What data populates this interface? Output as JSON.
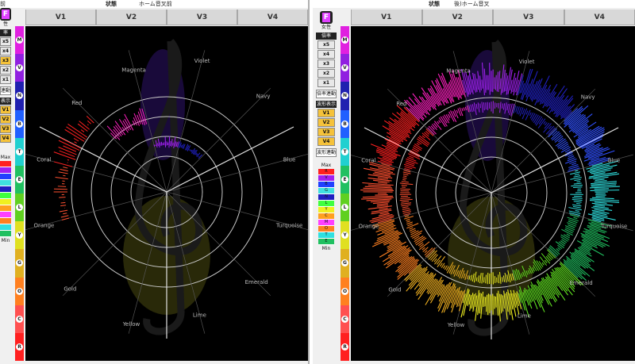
{
  "left": {
    "status_label": "状態",
    "status_value": "ホーム音叉前",
    "tabs": [
      "V1",
      "V2",
      "V3",
      "V4"
    ],
    "logo": "F",
    "partial_title": "前",
    "ctrl": {
      "gender": "性",
      "multiplier_header": "率",
      "multipliers": [
        "x5",
        "x4",
        "x3",
        "x2",
        "x1"
      ],
      "link_button": "連動",
      "wave_header": "表示",
      "wave_buttons": [
        "V1",
        "V2",
        "V3",
        "V4"
      ],
      "max_label": "Max",
      "min_label": "Min"
    }
  },
  "right": {
    "status_label": "状態",
    "status_value": "後)ホーム音叉",
    "tabs": [
      "V1",
      "V2",
      "V3",
      "V4"
    ],
    "logo": "F",
    "ctrl": {
      "gender": "女性",
      "multiplier_header": "倍率",
      "multipliers": [
        "x5",
        "x4",
        "x3",
        "x2",
        "x1"
      ],
      "link_button": "倍率連動",
      "wave_header": "波形表示",
      "wave_buttons": [
        "V1",
        "V2",
        "V3",
        "V4"
      ],
      "wave_link": "波形連動",
      "max_label": "Max",
      "swatches": [
        "R",
        "V",
        "B",
        "G",
        "N",
        "L",
        "Y",
        "C",
        "M",
        "O",
        "T",
        "E"
      ],
      "min_label": "Min"
    }
  },
  "strip_letters": [
    "M",
    "V",
    "N",
    "B",
    "T",
    "E",
    "L",
    "Y",
    "G",
    "O",
    "C",
    "R"
  ],
  "wheel_labels": [
    "Violet",
    "Navy",
    "Blue",
    "Turquoise",
    "Emerald",
    "Lime",
    "Yellow",
    "Gold",
    "Orange",
    "Coral",
    "Red",
    "Magenta"
  ],
  "colors": {
    "Violet": "#a020f0",
    "Navy": "#2020c0",
    "Blue": "#3050ff",
    "Turquoise": "#30e0e0",
    "Emerald": "#20c060",
    "Lime": "#60e020",
    "Yellow": "#f0f020",
    "Gold": "#f0b020",
    "Orange": "#ff8020",
    "Coral": "#ff5030",
    "Red": "#ff2020",
    "Magenta": "#ff20c0"
  },
  "strip_colors": [
    "#e020e0",
    "#9020e0",
    "#2020b0",
    "#2060ff",
    "#20d0d0",
    "#20c060",
    "#60d020",
    "#e0e020",
    "#e0b020",
    "#ff8020",
    "#ff5050",
    "#ff2020"
  ],
  "swatch_colors": [
    "#ff2020",
    "#a020f0",
    "#2040ff",
    "#40e0e0",
    "#2020c0",
    "#40ff40",
    "#f0f020",
    "#ffa020",
    "#ff40ff",
    "#ff8020",
    "#30e0e0",
    "#20c060"
  ]
}
